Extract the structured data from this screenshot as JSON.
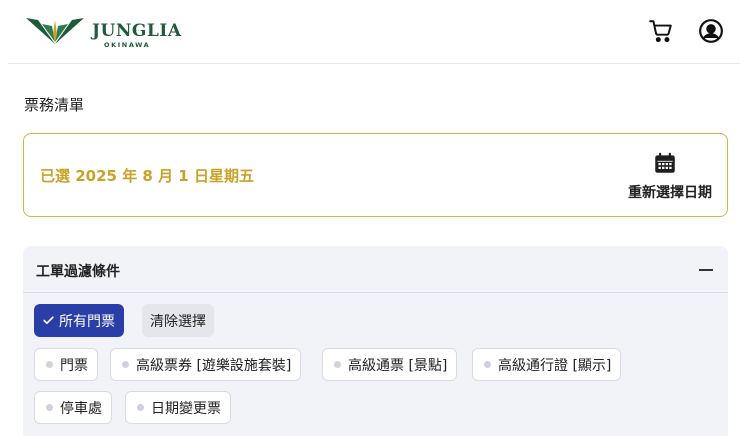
{
  "header": {
    "logo_main": "JUNGLIA",
    "logo_sub": "OKINAWA",
    "cart_icon": "shopping-cart-icon",
    "user_icon": "user-account-icon"
  },
  "page": {
    "section_title": "票務清單"
  },
  "date_card": {
    "selected_date": "已選 2025 年 8 月 1 日星期五",
    "reselect_label": "重新選擇日期",
    "icon": "calendar-icon"
  },
  "filter": {
    "title": "工單過濾條件",
    "all_label": "所有門票",
    "clear_label": "清除選擇",
    "chips": [
      {
        "label": "門票"
      },
      {
        "label": "高級票券 [遊樂設施套裝]"
      },
      {
        "label": "高級通票 [景點]"
      },
      {
        "label": "高級通行證 [顯示]"
      },
      {
        "label": "停車處"
      },
      {
        "label": "日期變更票"
      }
    ]
  },
  "colors": {
    "brand_green": "#1e5b3a",
    "accent_gold": "#c9a227",
    "primary_blue": "#2a3ea8",
    "filter_bg": "#f2f3f8"
  }
}
